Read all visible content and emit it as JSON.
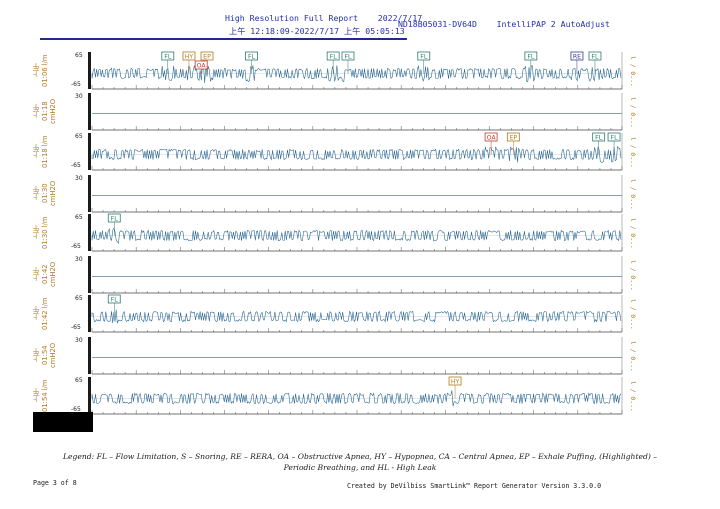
{
  "header": {
    "line1": "High Resolution Full Report    2022/7/17",
    "line1b": "ND18B05031-DV64D    IntelliPAP 2 AutoAdjust",
    "line2": "上午 12:18:09-2022/7/17 上午 05:05:13"
  },
  "lanes": [
    {
      "kind": "flow",
      "time": "上午 01:06",
      "unit": "l/m",
      "ymax": "65",
      "ymin": "-65",
      "right": "l / 0...",
      "events": [
        {
          "t": "FL",
          "c": "#2e7d6b",
          "x": 0.143
        },
        {
          "t": "HY",
          "c": "#b07a1f",
          "x": 0.183
        },
        {
          "t": "EP",
          "c": "#b07a1f",
          "x": 0.217
        },
        {
          "t": "OA",
          "c": "#c0392b",
          "x": 0.206,
          "low": true
        },
        {
          "t": "FL",
          "c": "#2e7d6b",
          "x": 0.301
        },
        {
          "t": "FL",
          "c": "#2e7d6b",
          "x": 0.455
        },
        {
          "t": "FL",
          "c": "#2e7d6b",
          "x": 0.483
        },
        {
          "t": "FL",
          "c": "#2e7d6b",
          "x": 0.626
        },
        {
          "t": "FL",
          "c": "#2e7d6b",
          "x": 0.828
        },
        {
          "t": "RE",
          "c": "#3b3b8f",
          "x": 0.915
        },
        {
          "t": "FL",
          "c": "#2e7d6b",
          "x": 0.949
        }
      ]
    },
    {
      "kind": "pressure",
      "time": "上午 01:18",
      "unit": "cmH2O",
      "ymax": "30",
      "right": "l / 0...",
      "events": []
    },
    {
      "kind": "flow",
      "time": "上午 01:18",
      "unit": "l/m",
      "ymax": "65",
      "ymin": "-65",
      "right": "l / 0...",
      "events": [
        {
          "t": "OA",
          "c": "#c0392b",
          "x": 0.753
        },
        {
          "t": "EP",
          "c": "#b07a1f",
          "x": 0.795
        },
        {
          "t": "FL",
          "c": "#2e7d6b",
          "x": 0.956
        },
        {
          "t": "FL",
          "c": "#2e7d6b",
          "x": 0.985
        }
      ]
    },
    {
      "kind": "pressure",
      "time": "上午 01:30",
      "unit": "cmH2O",
      "ymax": "30",
      "right": "l / 0...",
      "events": []
    },
    {
      "kind": "flow",
      "time": "上午 01:30",
      "unit": "l/m",
      "ymax": "65",
      "ymin": "-65",
      "right": "l / 0...",
      "events": [
        {
          "t": "FL",
          "c": "#2e7d6b",
          "x": 0.042
        }
      ]
    },
    {
      "kind": "pressure",
      "time": "上午 01:42",
      "unit": "cmH2O",
      "ymax": "30",
      "right": "l / 0...",
      "events": []
    },
    {
      "kind": "flow",
      "time": "上午 01:42",
      "unit": "l/m",
      "ymax": "65",
      "ymin": "-65",
      "right": "l / 0...",
      "events": [
        {
          "t": "FL",
          "c": "#2e7d6b",
          "x": 0.042
        }
      ]
    },
    {
      "kind": "pressure",
      "time": "上午 01:54",
      "unit": "cmH2O",
      "ymax": "30",
      "right": "l / 0...",
      "events": []
    },
    {
      "kind": "flow",
      "time": "上午 01:54",
      "unit": "l/m",
      "ymax": "65",
      "ymin": "-65",
      "right": "l / 0...",
      "events": [
        {
          "t": "HY",
          "c": "#b07a1f",
          "x": 0.685
        }
      ]
    }
  ],
  "legend": {
    "line1": "Legend: FL – Flow Limitation, S – Snoring, RE – RERA, OA – Obstructive Apnea, HY – Hypopnea, CA – Central Apnea, EP – Exhale Puffing,  (Highlighted) –",
    "line2": "Periodic Breathing, and HL - High Leak"
  },
  "footer": {
    "page": "Page 3 of 8",
    "created": "Created by DeVilbiss SmartLink™ Report Generator Version 3.3.0.0"
  },
  "colors": {
    "wave": "#1f5f8c",
    "axis": "#9aa0a6",
    "label": "#b07a1f"
  }
}
